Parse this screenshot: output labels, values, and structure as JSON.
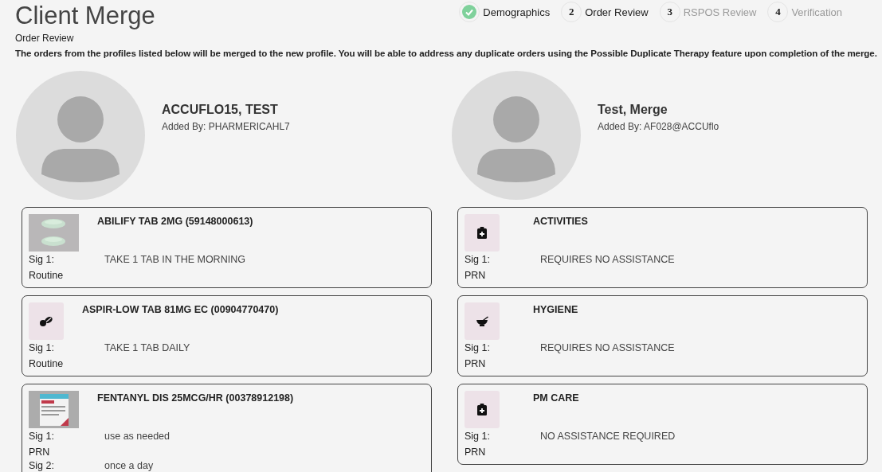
{
  "title": "Client Merge",
  "steps": [
    {
      "label": "Demographics",
      "completed": true,
      "disabled": false
    },
    {
      "number": "2",
      "label": "Order Review",
      "completed": false,
      "disabled": false
    },
    {
      "number": "3",
      "label": "RSPOS Review",
      "completed": false,
      "disabled": true
    },
    {
      "number": "4",
      "label": "Verification",
      "completed": false,
      "disabled": true
    }
  ],
  "subtitle": "Order Review",
  "description": "The orders from the profiles listed below will be merged to the new profile. You will be able to address any duplicate orders using the Possible Duplicate Therapy feature upon completion of the merge.",
  "profiles": [
    {
      "name": "ACCUFLO15, TEST",
      "added_by": "Added By: PHARMERICAHL7",
      "orders": [
        {
          "kind": "pills-photo",
          "title": "ABILIFY TAB 2MG (59148000613)",
          "sigs": [
            {
              "label": "Sig 1:",
              "text": "TAKE 1 TAB IN THE MORNING",
              "frequency": "Routine"
            }
          ]
        },
        {
          "kind": "pills-icon",
          "title": "ASPIR-LOW TAB 81MG EC (00904770470)",
          "sigs": [
            {
              "label": "Sig 1:",
              "text": "TAKE 1 TAB DAILY",
              "frequency": "Routine"
            }
          ]
        },
        {
          "kind": "box-photo",
          "title": "FENTANYL DIS 25MCG/HR (00378912198)",
          "sigs": [
            {
              "label": "Sig 1:",
              "text": "use as needed",
              "frequency": "PRN"
            },
            {
              "label": "Sig 2:",
              "text": "once a day"
            }
          ]
        }
      ]
    },
    {
      "name": "Test, Merge",
      "added_by": "Added By: AF028@ACCUflo",
      "orders": [
        {
          "kind": "clipboard-icon",
          "title": "ACTIVITIES",
          "sigs": [
            {
              "label": "Sig 1:",
              "text": "REQUIRES NO ASSISTANCE",
              "frequency": "PRN"
            }
          ]
        },
        {
          "kind": "mortar-icon",
          "title": "HYGIENE",
          "sigs": [
            {
              "label": "Sig 1:",
              "text": "REQUIRES NO ASSISTANCE",
              "frequency": "PRN"
            }
          ]
        },
        {
          "kind": "clipboard-icon",
          "title": "PM CARE",
          "sigs": [
            {
              "label": "Sig 1:",
              "text": "NO ASSISTANCE REQUIRED",
              "frequency": "PRN"
            }
          ]
        }
      ]
    }
  ]
}
